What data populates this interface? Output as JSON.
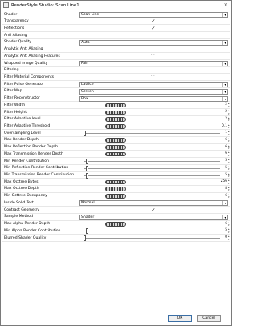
{
  "window": {
    "title": "RenderStyle Studio: Scan Line1",
    "close_icon": "×"
  },
  "rows": [
    {
      "label": "Shader",
      "type": "combo",
      "value": "Scan Line"
    },
    {
      "label": "Transparency",
      "type": "check",
      "checked": true
    },
    {
      "label": "Reflections",
      "type": "check",
      "checked": true
    },
    {
      "label": "Anti Aliasing",
      "type": "check",
      "checked": false
    },
    {
      "label": "Shader Quality",
      "type": "combo",
      "value": "Auto"
    },
    {
      "label": "Analytic Anti Aliasing",
      "type": "check",
      "checked": false
    },
    {
      "label": "Analytic Anti Aliasing Features",
      "type": "dots"
    },
    {
      "label": "Wrapped Image Quality",
      "type": "combo",
      "value": "Fair"
    },
    {
      "label": "Filtering",
      "type": "check",
      "checked": false
    },
    {
      "label": "Filter Material Components",
      "type": "dots"
    },
    {
      "label": "Filter Pulse Generator",
      "type": "combo",
      "value": "Lattice"
    },
    {
      "label": "Filter Map",
      "type": "combo",
      "value": "Screen"
    },
    {
      "label": "Filter Reconstructor",
      "type": "combo",
      "value": "Box"
    },
    {
      "label": "Filter Width",
      "type": "pill",
      "value": "2"
    },
    {
      "label": "Filter Height",
      "type": "pill",
      "value": "2"
    },
    {
      "label": "Filter Adaptive level",
      "type": "pill",
      "value": "2"
    },
    {
      "label": "Filter Adaptive Threshold",
      "type": "pill",
      "value": "0.1"
    },
    {
      "label": "Oversampling Level",
      "type": "slider",
      "value": "1",
      "level": 0.0
    },
    {
      "label": "Max Render Depth",
      "type": "pill",
      "value": "6"
    },
    {
      "label": "Max Reflection Render Depth",
      "type": "pill",
      "value": "6"
    },
    {
      "label": "Max Transmission Render Depth",
      "type": "pill",
      "value": "6"
    },
    {
      "label": "Min Render Contribution",
      "type": "slider",
      "value": "5",
      "level": 0.02
    },
    {
      "label": "Min Reflection Render Contribution",
      "type": "slider",
      "value": "5",
      "level": 0.02
    },
    {
      "label": "Min Transmission Render Contribution",
      "type": "slider",
      "value": "5",
      "level": 0.02
    },
    {
      "label": "Max Octtree Bytes",
      "type": "pill",
      "value": "256"
    },
    {
      "label": "Max Octtree Depth",
      "type": "pill",
      "value": "8"
    },
    {
      "label": "Min Octtree Occupancy",
      "type": "pill",
      "value": "6"
    },
    {
      "label": "Inside Solid Test",
      "type": "combo",
      "value": "Normal"
    },
    {
      "label": "Contract Geometry",
      "type": "check",
      "checked": true
    },
    {
      "label": "Sample Method",
      "type": "combo",
      "value": "Shader"
    },
    {
      "label": "Max Alpha Render Depth",
      "type": "pill",
      "value": "6"
    },
    {
      "label": "Min Alpha Render Contribution",
      "type": "slider",
      "value": "5",
      "level": 0.02
    },
    {
      "label": "Blurred Shader Quality",
      "type": "slider",
      "value": "0",
      "level": 0.0
    }
  ],
  "footer": {
    "ok_label": "OK",
    "cancel_label": "Cancel"
  }
}
